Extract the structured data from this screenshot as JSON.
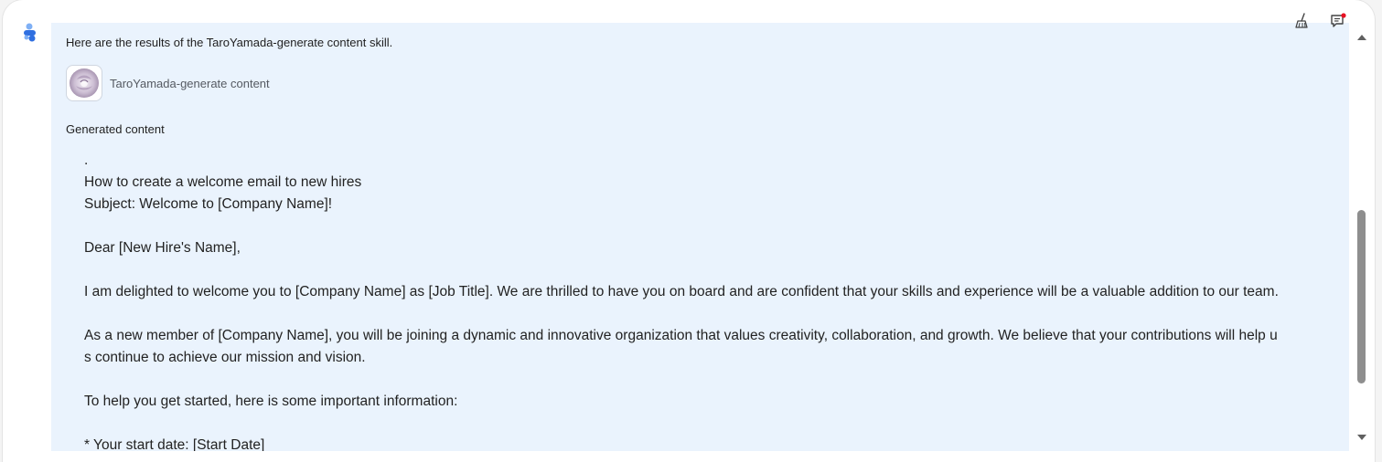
{
  "message": {
    "intro": "Here are the results of the TaroYamada-generate content skill.",
    "skill": {
      "name": "TaroYamada-generate content",
      "icon": "skill-thumbnail-icon"
    },
    "section_label": "Generated content",
    "content_lines": [
      ".",
      "How to create a welcome email to new hires",
      "Subject: Welcome to [Company Name]!",
      "",
      "Dear [New Hire's Name],",
      "",
      "I am delighted to welcome you to [Company Name] as [Job Title]. We are thrilled to have you on board and are confident that your skills and experience will be a valuable addition to our team.",
      "",
      "As a new member of [Company Name], you will be joining a dynamic and innovative organization that values creativity, collaboration, and growth. We believe that your contributions will help u",
      "s continue to achieve our mission and vision.",
      "",
      "To help you get started, here is some important information:",
      "",
      "* Your start date: [Start Date]"
    ]
  },
  "toolbar": {
    "clean_icon": "broom-icon",
    "feedback_icon": "feedback-icon",
    "notification_dot_color": "#e81123"
  },
  "scrollbar": {
    "up_icon": "scroll-up-arrow-icon",
    "down_icon": "scroll-down-arrow-icon"
  },
  "colors": {
    "bubble_background": "#eaf3fd",
    "avatar_primary": "#2f6fe0",
    "avatar_secondary": "#7fb0f5"
  }
}
